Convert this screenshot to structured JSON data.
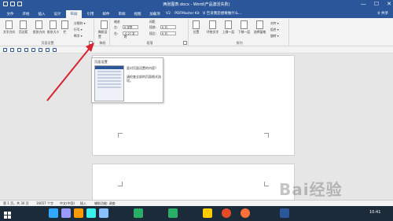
{
  "window": {
    "title": "两张图表.docx - Word(产品激活失败)",
    "controls": [
      "—",
      "☐",
      "✕"
    ]
  },
  "tabs": [
    {
      "label": "文件"
    },
    {
      "label": "开始"
    },
    {
      "label": "插入"
    },
    {
      "label": "设计"
    },
    {
      "label": "布局",
      "active": true
    },
    {
      "label": "引用"
    },
    {
      "label": "邮件"
    },
    {
      "label": "审阅"
    },
    {
      "label": "视图"
    },
    {
      "label": "加载项"
    },
    {
      "label": "V2"
    },
    {
      "label": "PDFMaster Kit"
    }
  ],
  "tab_search": "♀ 告诉我您想要做什么...",
  "share": "♀ 共享",
  "ribbon": {
    "page_setup": {
      "buttons": [
        "文字方向",
        "页边距",
        "纸张方向",
        "纸张大小",
        "栏"
      ],
      "small": [
        "分隔符 ▾",
        "行号 ▾",
        "断字 ▾"
      ],
      "label": "页面设置"
    },
    "manuscript": {
      "button": "稿纸设置",
      "label": "稿纸"
    },
    "indent": {
      "title": "缩进",
      "left_label": "左:",
      "left_value": "0 字符",
      "right_label": "右:",
      "right_value": "-0.27 字符"
    },
    "spacing": {
      "title": "间距",
      "before_label": "段前:",
      "before_value": "0 行",
      "after_label": "段后:",
      "after_value": "0 行"
    },
    "paragraph_label": "段落",
    "arrange": {
      "buttons": [
        "位置",
        "环绕文字",
        "上移一层",
        "下移一层",
        "选择窗格"
      ],
      "small": [
        "对齐 ▾",
        "组合 ▾",
        "旋转 ▾"
      ],
      "label": "排列"
    }
  },
  "tooltip": {
    "title": "页面设置",
    "line1": "面对页面设置的内容？",
    "line2": "请检查全部的页面格式选项。"
  },
  "statusbar": {
    "page": "第 1 页，共 30 页",
    "words": "16657 个字",
    "lang": "中文(中国)",
    "mode": "插入",
    "accessibility": "辅助功能: 调查"
  },
  "taskbar": {
    "time": "10:41",
    "icons": [
      {
        "name": "start",
        "color": "#ffffff"
      },
      {
        "name": "word",
        "color": "#2b579a"
      },
      {
        "name": "photoshop",
        "color": "#31a8ff"
      },
      {
        "name": "premiere",
        "color": "#9999ff"
      },
      {
        "name": "illustrator",
        "color": "#ff9a00"
      },
      {
        "name": "lightroom",
        "color": "#3df0f0"
      },
      {
        "name": "app-icon",
        "color": "#88c0ff"
      },
      {
        "name": "wechat",
        "color": "#2aae67"
      },
      {
        "name": "qq",
        "color": "#ffcc00"
      },
      {
        "name": "chrome",
        "color": "#e34c26"
      },
      {
        "name": "firefox",
        "color": "#ff7139"
      },
      {
        "name": "terminal",
        "color": "#444444"
      }
    ]
  },
  "watermark": "Bai经验"
}
